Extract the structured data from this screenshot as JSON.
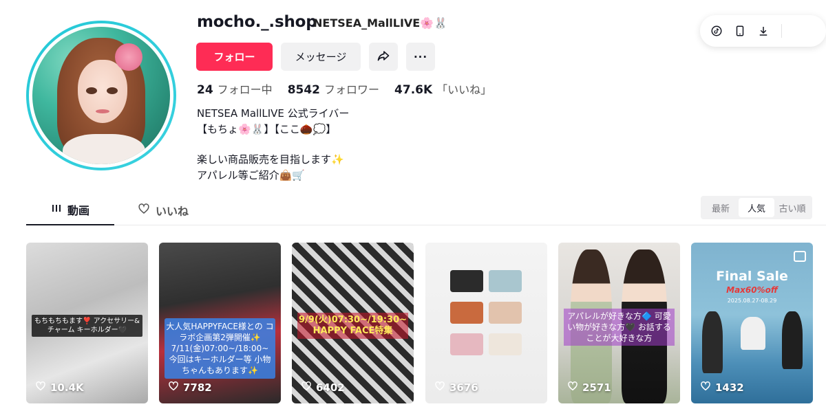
{
  "profile": {
    "username": "mocho._.shop",
    "nickname": "NETSEA_MallLIVE🌸🐰"
  },
  "actions": {
    "follow_label": "フォロー",
    "message_label": "メッセージ",
    "more_label": "···"
  },
  "stats": {
    "following": {
      "value": "24",
      "label": "フォロー中"
    },
    "followers": {
      "value": "8542",
      "label": "フォロワー"
    },
    "likes": {
      "value": "47.6K",
      "label": "「いいね」"
    }
  },
  "bio": {
    "line1": "NETSEA MallLIVE 公式ライバー",
    "line2": "【もちょ🌸🐰】【ここ🌰💭】",
    "line3": "楽しい商品販売を目指します✨",
    "line4": "アパレル等ご紹介👜🛒"
  },
  "toolbar": {
    "icons": [
      "tiktok-icon",
      "mobile-icon",
      "download-icon"
    ]
  },
  "tabs": {
    "videos_label": "動画",
    "liked_label": "いいね"
  },
  "sort": {
    "options": [
      "最新",
      "人気",
      "古い順"
    ],
    "selected": "人気"
  },
  "videos": [
    {
      "likes": "10.4K",
      "caption": "もちもちもます❣️ アクセサリー&チャーム キーホルダー🖤"
    },
    {
      "likes": "7782",
      "caption": "大人気HAPPYFACE様との コラボ企画第2弾開催✨ 7/11(金)07:00~/18:00~ 今回はキーホルダー等 小物ちゃんもあります✨"
    },
    {
      "likes": "6402",
      "caption": "9/9(火)07:30~/19:30~ HAPPY FACE特集"
    },
    {
      "likes": "3676",
      "caption": ""
    },
    {
      "likes": "2571",
      "caption": "アパレルが好きな方🔷 可愛い物が好きな方🖤 お話することが大好きな方"
    },
    {
      "likes": "1432",
      "title": "Final Sale",
      "subtitle": "Max60%off",
      "date": "2025.08.27-08.29"
    }
  ],
  "colors": {
    "primary": "#fe2c55",
    "avatar_ring": "#25c8d6",
    "text": "#161823"
  }
}
